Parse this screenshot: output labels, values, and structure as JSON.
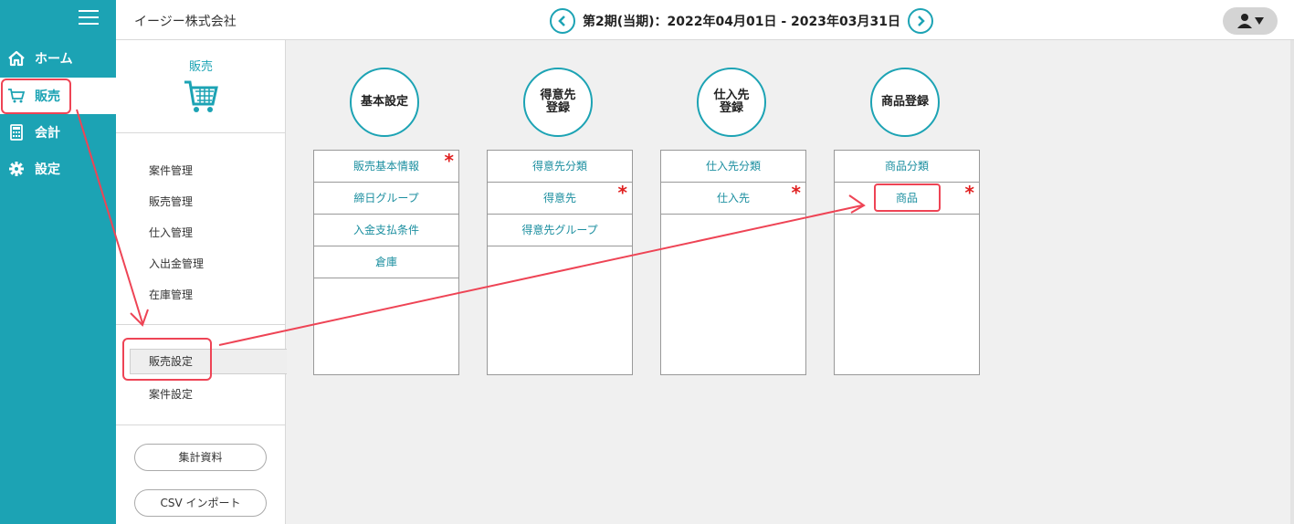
{
  "rail": {
    "items": [
      {
        "label": "ホーム",
        "icon": "home-icon"
      },
      {
        "label": "販売",
        "icon": "cart-icon"
      },
      {
        "label": "会計",
        "icon": "calculator-icon"
      },
      {
        "label": "設定",
        "icon": "gear-icon"
      }
    ]
  },
  "header": {
    "company": "イージー株式会社",
    "period": "第2期(当期)：2022年04月01日 - 2023年03月31日"
  },
  "subnav": {
    "title": "販売",
    "items": [
      "案件管理",
      "販売管理",
      "仕入管理",
      "入出金管理",
      "在庫管理"
    ],
    "settings": [
      "販売設定",
      "案件設定"
    ],
    "buttons": [
      "集計資料",
      "CSV インポート"
    ]
  },
  "columns": [
    {
      "title": "基本設定",
      "rows": [
        {
          "label": "販売基本情報",
          "required": "*"
        },
        {
          "label": "締日グループ",
          "required": ""
        },
        {
          "label": "入金支払条件",
          "required": ""
        },
        {
          "label": "倉庫",
          "required": ""
        }
      ]
    },
    {
      "title": "得意先\n登録",
      "rows": [
        {
          "label": "得意先分類",
          "required": ""
        },
        {
          "label": "得意先",
          "required": "*"
        },
        {
          "label": "得意先グループ",
          "required": ""
        }
      ]
    },
    {
      "title": "仕入先\n登録",
      "rows": [
        {
          "label": "仕入先分類",
          "required": ""
        },
        {
          "label": "仕入先",
          "required": "*"
        }
      ]
    },
    {
      "title": "商品登録",
      "rows": [
        {
          "label": "商品分類",
          "required": ""
        },
        {
          "label": "商品",
          "required": "*"
        }
      ]
    }
  ],
  "colors": {
    "accent": "#1ca3b4",
    "required": "#e02020",
    "annotation": "#ee4455"
  }
}
